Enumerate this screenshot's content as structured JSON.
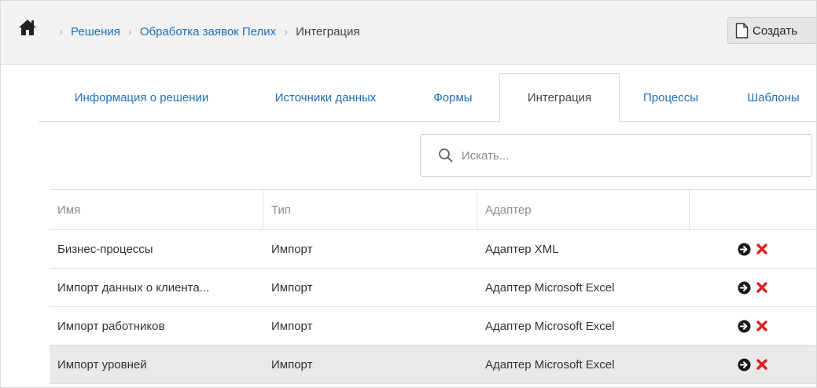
{
  "breadcrumb": {
    "items": [
      "Решения",
      "Обработка заявок Пелих"
    ],
    "current": "Интеграция"
  },
  "toolbar": {
    "create_label": "Создать"
  },
  "tabs": [
    {
      "label": "Информация о решении",
      "active": false
    },
    {
      "label": "Источники данных",
      "active": false
    },
    {
      "label": "Формы",
      "active": false
    },
    {
      "label": "Интеграция",
      "active": true
    },
    {
      "label": "Процессы",
      "active": false
    },
    {
      "label": "Шаблоны",
      "active": false
    }
  ],
  "search": {
    "placeholder": "Искать...",
    "value": ""
  },
  "table": {
    "columns": [
      "Имя",
      "Тип",
      "Адаптер",
      ""
    ],
    "rows": [
      {
        "name": "Бизнес-процессы",
        "type": "Импорт",
        "adapter": "Адаптер XML"
      },
      {
        "name": "Импорт данных о клиента...",
        "type": "Импорт",
        "adapter": "Адаптер Microsoft Excel"
      },
      {
        "name": "Импорт работников",
        "type": "Импорт",
        "adapter": "Адаптер Microsoft Excel"
      },
      {
        "name": "Импорт уровней",
        "type": "Импорт",
        "adapter": "Адаптер Microsoft Excel"
      }
    ]
  },
  "icons": {
    "home": "home-icon",
    "create": "document-icon",
    "search": "search-icon",
    "open": "arrow-circle-right-icon",
    "delete": "close-icon"
  },
  "colors": {
    "link": "#1e6fb8",
    "delete": "#e02020",
    "highlight_row": "#e9e9e9"
  }
}
